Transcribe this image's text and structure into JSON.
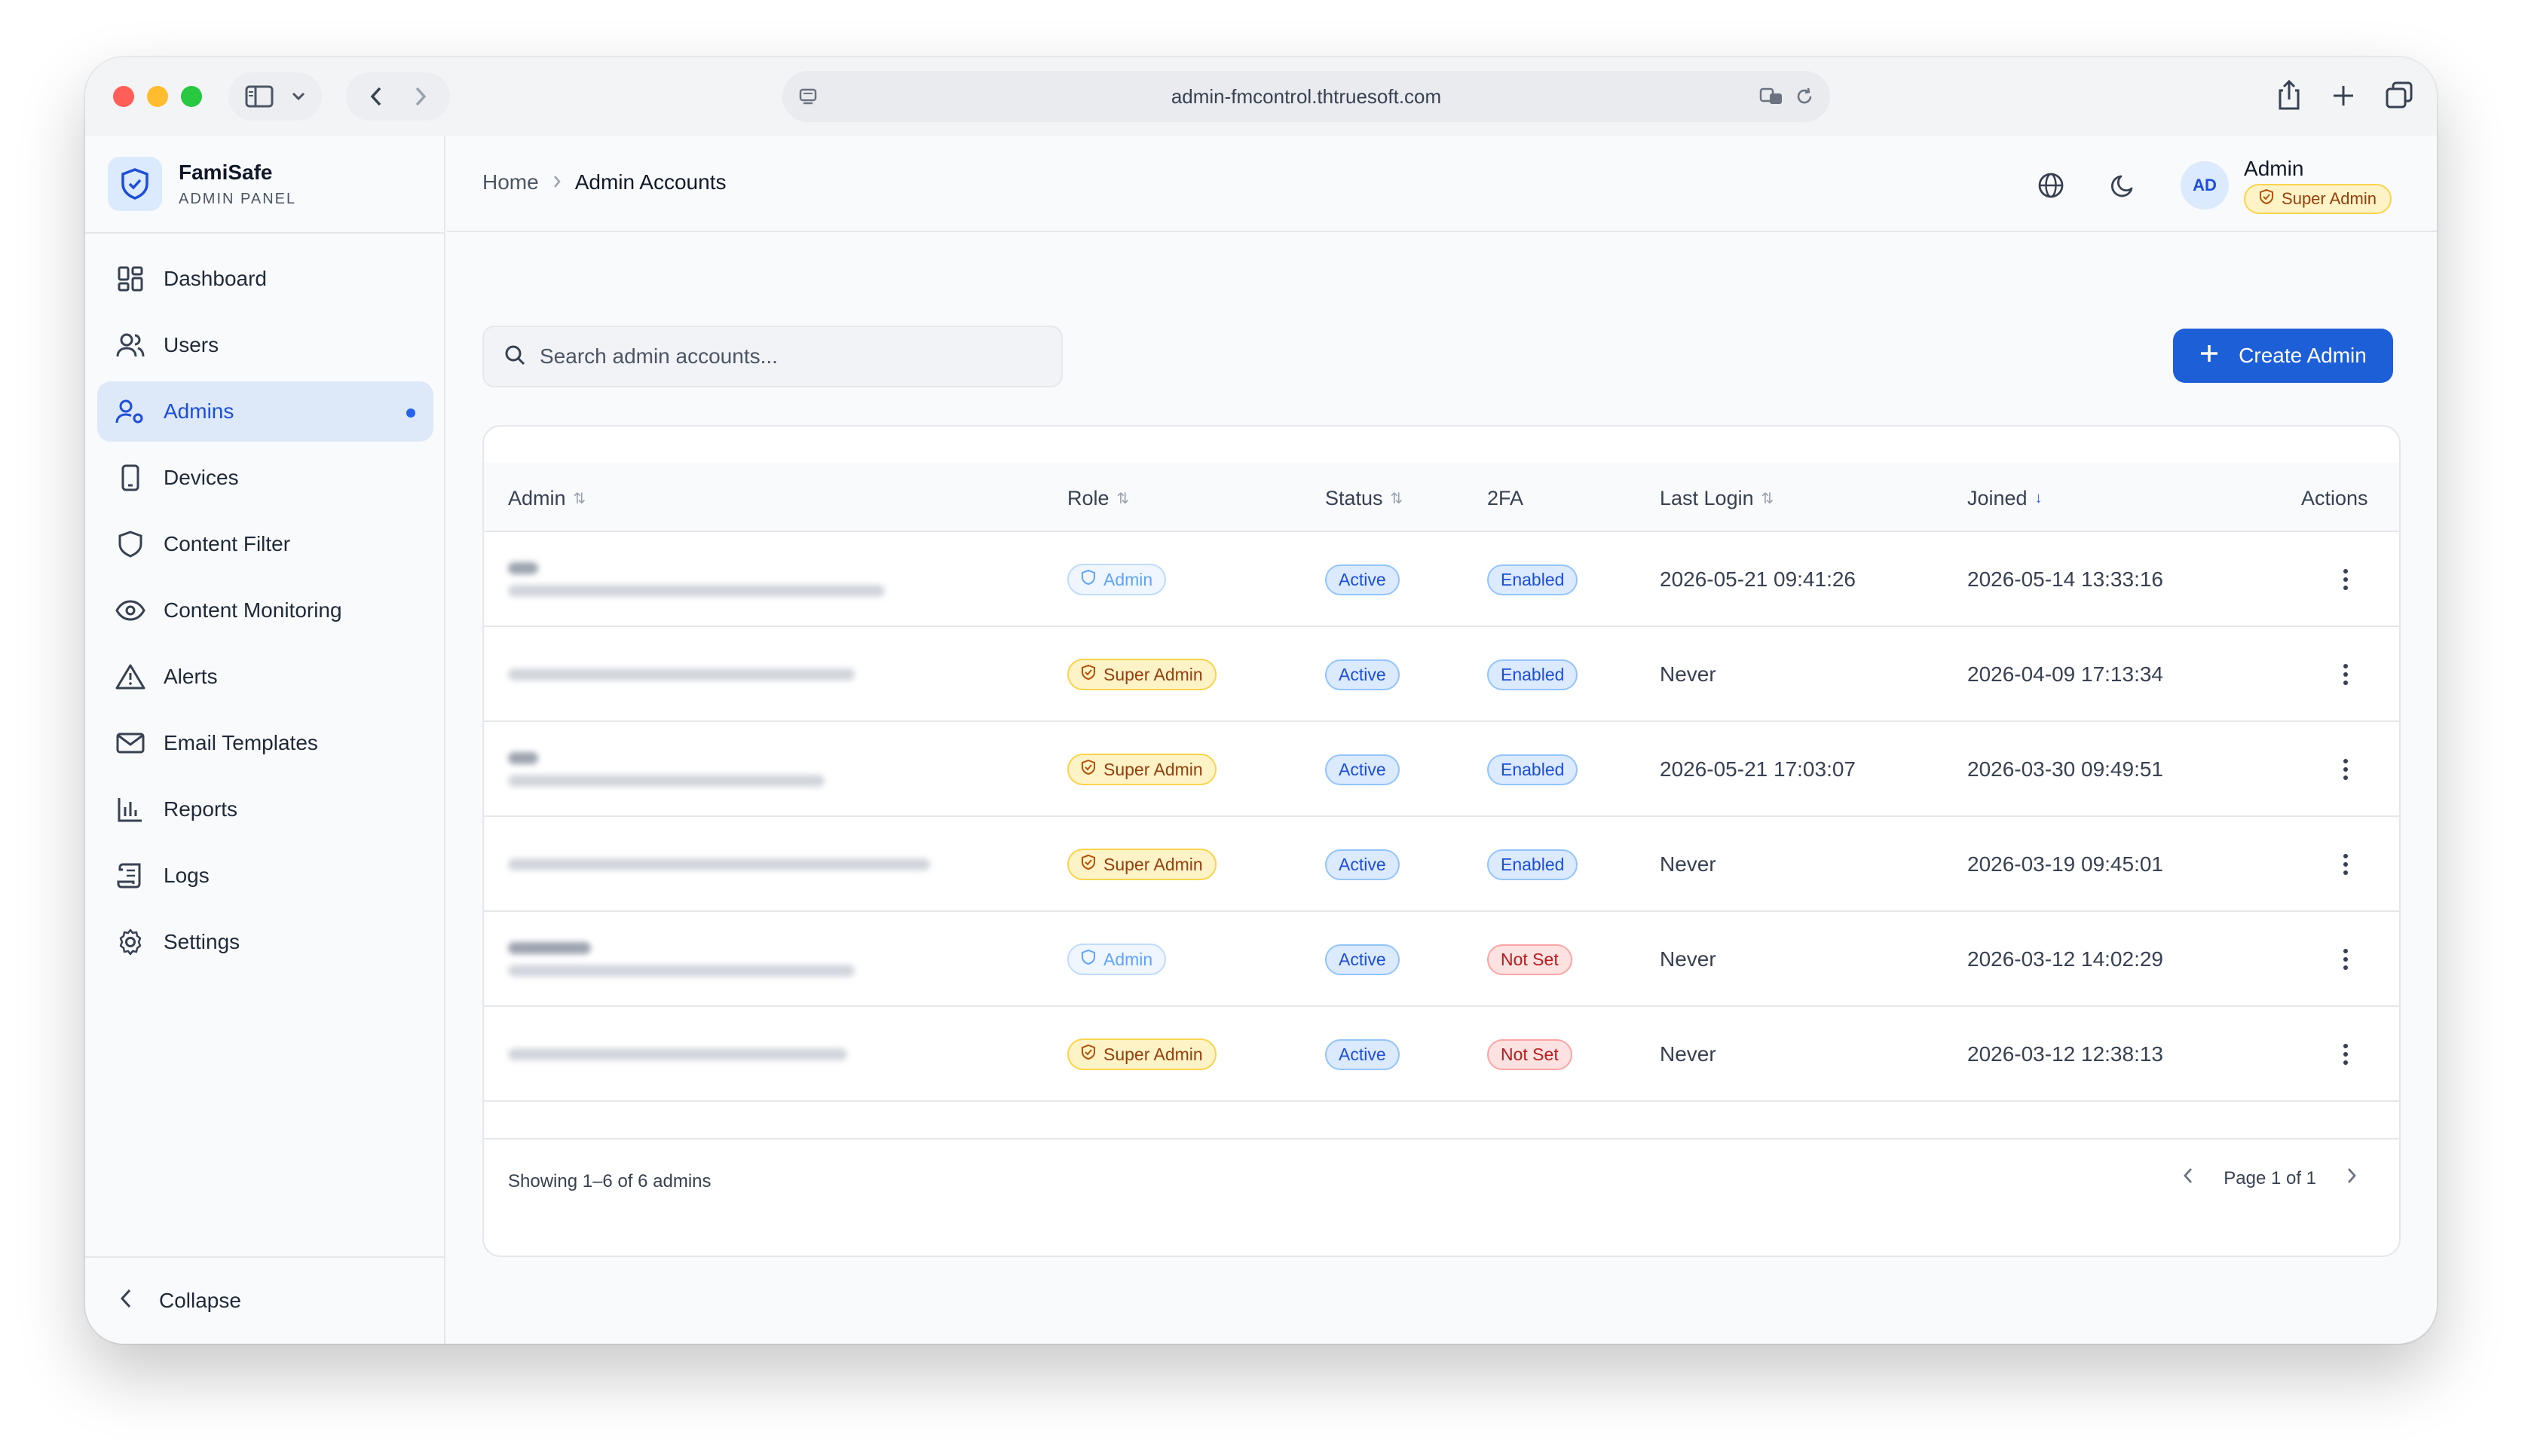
{
  "browser": {
    "url": "admin-fmcontrol.thtruesoft.com"
  },
  "brand": {
    "name": "FamiSafe",
    "subtitle": "ADMIN PANEL"
  },
  "sidebar": {
    "items": [
      {
        "label": "Dashboard",
        "icon": "dashboard-icon"
      },
      {
        "label": "Users",
        "icon": "users-icon"
      },
      {
        "label": "Admins",
        "icon": "admin-user-icon",
        "active": true
      },
      {
        "label": "Devices",
        "icon": "device-icon"
      },
      {
        "label": "Content Filter",
        "icon": "shield-icon"
      },
      {
        "label": "Content Monitoring",
        "icon": "eye-icon"
      },
      {
        "label": "Alerts",
        "icon": "alert-triangle-icon"
      },
      {
        "label": "Email Templates",
        "icon": "mail-icon"
      },
      {
        "label": "Reports",
        "icon": "bar-chart-icon"
      },
      {
        "label": "Logs",
        "icon": "scroll-icon"
      },
      {
        "label": "Settings",
        "icon": "gear-icon"
      }
    ],
    "collapse_label": "Collapse"
  },
  "header": {
    "breadcrumb_home": "Home",
    "breadcrumb_current": "Admin Accounts",
    "avatar_initials": "AD",
    "user_name": "Admin",
    "user_role": "Super Admin"
  },
  "toolbar": {
    "search_placeholder": "Search admin accounts...",
    "create_label": "Create Admin"
  },
  "table": {
    "columns": {
      "admin": "Admin",
      "role": "Role",
      "status": "Status",
      "twofa": "2FA",
      "last_login": "Last Login",
      "joined": "Joined",
      "actions": "Actions"
    },
    "rows": [
      {
        "role": "Admin",
        "status": "Active",
        "twofa": "Enabled",
        "last_login": "2026-05-21 09:41:26",
        "joined": "2026-05-14 13:33:16"
      },
      {
        "role": "Super Admin",
        "status": "Active",
        "twofa": "Enabled",
        "last_login": "Never",
        "joined": "2026-04-09 17:13:34"
      },
      {
        "role": "Super Admin",
        "status": "Active",
        "twofa": "Enabled",
        "last_login": "2026-05-21 17:03:07",
        "joined": "2026-03-30 09:49:51"
      },
      {
        "role": "Super Admin",
        "status": "Active",
        "twofa": "Enabled",
        "last_login": "Never",
        "joined": "2026-03-19 09:45:01"
      },
      {
        "role": "Admin",
        "status": "Active",
        "twofa": "Not Set",
        "last_login": "Never",
        "joined": "2026-03-12 14:02:29"
      },
      {
        "role": "Super Admin",
        "status": "Active",
        "twofa": "Not Set",
        "last_login": "Never",
        "joined": "2026-03-12 12:38:13"
      }
    ],
    "footer_text": "Showing 1–6 of 6 admins",
    "page_text": "Page 1 of 1"
  },
  "colors": {
    "accent": "#1d5fd6",
    "active_nav_bg": "#dde8f8",
    "super_admin_badge": "#fef3c7",
    "not_set_badge": "#fee2e2"
  }
}
